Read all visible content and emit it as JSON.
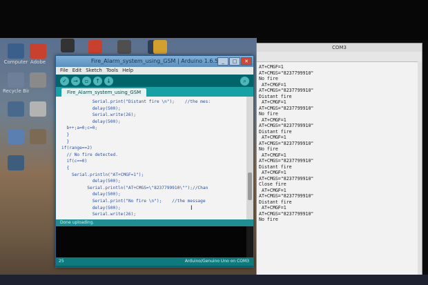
{
  "desktop": {
    "icons": [
      {
        "label": "Computer",
        "color": "#3a5f8a"
      },
      {
        "label": "Adobe",
        "color": "#c8412f"
      },
      {
        "label": "Recycle Bin",
        "color": "#6d7f99"
      },
      {
        "label": "",
        "color": "#8a8a8a"
      },
      {
        "label": "",
        "color": "#49698c"
      },
      {
        "label": "",
        "color": "#b3b3b3"
      },
      {
        "label": "",
        "color": "#5a7fb0"
      },
      {
        "label": "",
        "color": "#7d6a55"
      },
      {
        "label": "",
        "color": "#3e5c7c"
      }
    ],
    "top_icons": [
      {
        "color": "#333"
      },
      {
        "color": "#c8412f"
      },
      {
        "color": "#4f4f4f"
      },
      {
        "color": "#2c3e58"
      },
      {
        "color": "#d2a02e"
      }
    ]
  },
  "ide": {
    "title": "Fire_Alarm_system_using_GSM | Arduino 1.6.5",
    "menu": [
      "File",
      "Edit",
      "Sketch",
      "Tools",
      "Help"
    ],
    "toolbar_icons": [
      "verify-icon",
      "upload-icon",
      "new-icon",
      "open-icon",
      "save-icon"
    ],
    "tab_label": "Fire_Alarm_system_using_GSM",
    "code": [
      "            Serial.print(\"Distant fire \\n\");    //the mes:",
      "            delay(500);",
      "            Serial.write(26);",
      "            delay(500);",
      "  b++;a=0;c=0;",
      "  }",
      "  }",
      "if(range==2)",
      "  // No fire detected.",
      "  if(c==0)",
      "  {",
      "    Serial.println(\"AT+CMGF=1\");",
      "            delay(500);",
      "          Serial.println(\"AT+CMGS=\\\"8237799910\\\"\");//Chan",
      "            delay(500);",
      "            Serial.print(\"No fire \\n\");    //the message",
      "            delay(500);",
      "            Serial.write(26);"
    ],
    "status": "Done uploading.",
    "footer_line": "25",
    "footer_board": "Arduino/Genuino Uno on COM3"
  },
  "serial": {
    "title": "COM3",
    "lines": [
      "AT+CMGF=1",
      "AT+CMGS=\"8237799910\"",
      "No fire",
      " AT+CMGF=1",
      "AT+CMGS=\"8237799910\"",
      "Distant fire",
      " AT+CMGF=1",
      "AT+CMGS=\"8237799910\"",
      "No fire",
      " AT+CMGF=1",
      "AT+CMGS=\"8237799910\"",
      "Distant fire",
      " AT+CMGF=1",
      "AT+CMGS=\"8237799910\"",
      "No fire",
      " AT+CMGF=1",
      "AT+CMGS=\"8237799910\"",
      "Distant fire",
      " AT+CMGF=1",
      "AT+CMGS=\"8237799910\"",
      "Close fire",
      " AT+CMGF=1",
      "AT+CMGS=\"8237799910\"",
      "Distant fire",
      " AT+CMGF=1",
      "AT+CMGS=\"8237799910\"",
      "No fire"
    ]
  }
}
